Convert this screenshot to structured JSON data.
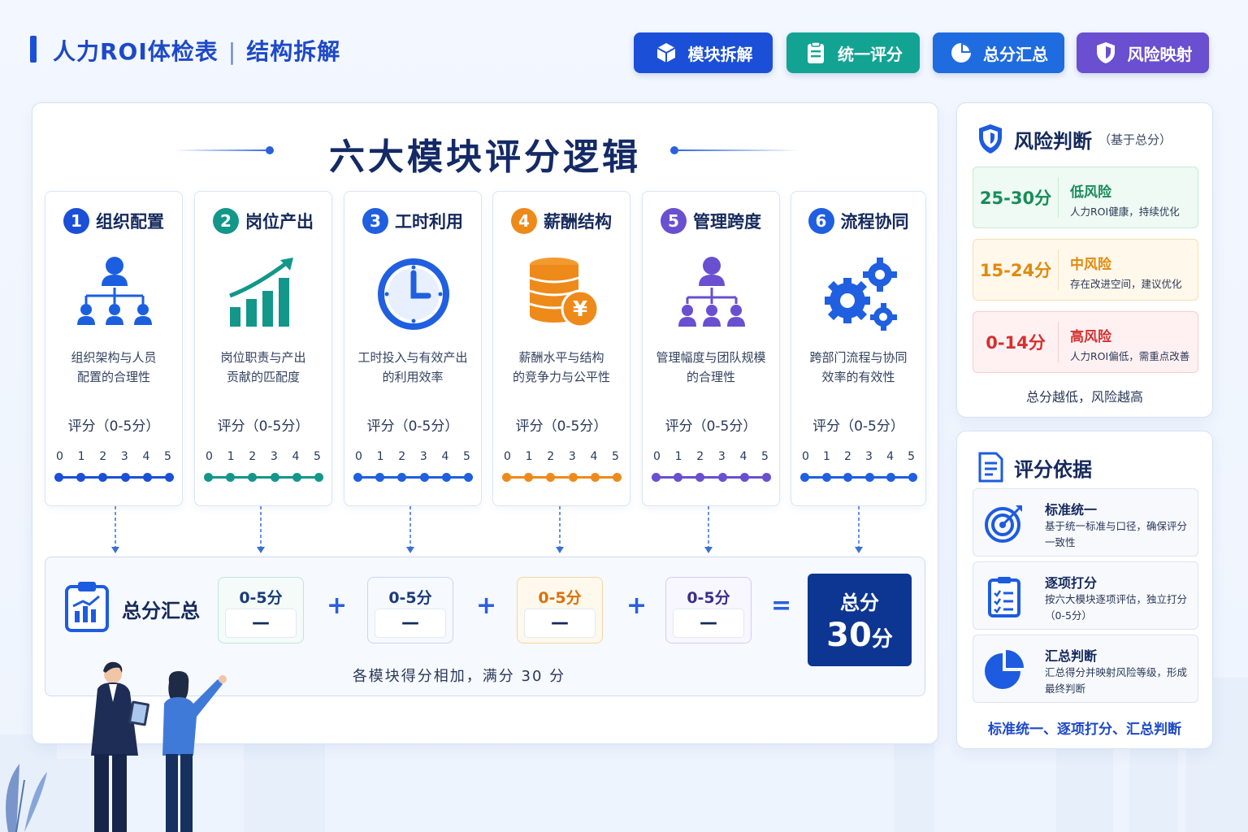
{
  "header": {
    "title": "人力ROI体检表",
    "subtitle": "结构拆解"
  },
  "tabs": [
    {
      "label": "模块拆解",
      "color": "#1b4fd8",
      "icon": "cube-icon"
    },
    {
      "label": "统一评分",
      "color": "#12a393",
      "icon": "clipboard-icon"
    },
    {
      "label": "总分汇总",
      "color": "#1f6be0",
      "icon": "pie-chart-icon"
    },
    {
      "label": "风险映射",
      "color": "#6a4fd0",
      "icon": "shield-icon"
    }
  ],
  "main": {
    "title": "六大模块评分逻辑",
    "modules": [
      {
        "num": "1",
        "name": "组织配置",
        "desc1": "组织架构与人员",
        "desc2": "配置的合理性",
        "score": "评分（0-5分）",
        "color": "#1b4fd8",
        "icon": "org-chart-icon"
      },
      {
        "num": "2",
        "name": "岗位产出",
        "desc1": "岗位职责与产出",
        "desc2": "贡献的匹配度",
        "score": "评分（0-5分）",
        "color": "#12978a",
        "icon": "growth-chart-icon"
      },
      {
        "num": "3",
        "name": "工时利用",
        "desc1": "工时投入与有效产出",
        "desc2": "的利用效率",
        "score": "评分（0-5分）",
        "color": "#1f5fe0",
        "icon": "clock-icon"
      },
      {
        "num": "4",
        "name": "薪酬结构",
        "desc1": "薪酬水平与结构",
        "desc2": "的竞争力与公平性",
        "score": "评分（0-5分）",
        "color": "#ee8a1a",
        "icon": "coins-yen-icon"
      },
      {
        "num": "5",
        "name": "管理跨度",
        "desc1": "管理幅度与团队规模",
        "desc2": "的合理性",
        "score": "评分（0-5分）",
        "color": "#6a4fd0",
        "icon": "hierarchy-icon"
      },
      {
        "num": "6",
        "name": "流程协同",
        "desc1": "跨部门流程与协同",
        "desc2": "效率的有效性",
        "score": "评分（0-5分）",
        "color": "#1f5fe0",
        "icon": "gears-icon"
      }
    ],
    "scale_labels": [
      "0",
      "1",
      "2",
      "3",
      "4",
      "5"
    ]
  },
  "summary": {
    "label": "总分汇总",
    "boxes": [
      {
        "value": "0-5分",
        "dash": "—",
        "color": "#1b3c7a",
        "border": "#bfe6da",
        "bg": "#f4fbf8"
      },
      {
        "value": "0-5分",
        "dash": "—",
        "color": "#1b3c7a",
        "border": "#c9d7ee",
        "bg": "#f6f9fe"
      },
      {
        "value": "0-5分",
        "dash": "—",
        "color": "#d9720c",
        "border": "#f3d7a6",
        "bg": "#fff8ec"
      },
      {
        "value": "0-5分",
        "dash": "—",
        "color": "#3b2f8a",
        "border": "#d6cdf0",
        "bg": "#f8f6fe"
      }
    ],
    "ops": [
      "+",
      "+",
      "+",
      "="
    ],
    "total_label": "总分",
    "total_value": "30",
    "total_unit": "分",
    "footnote": "各模块得分相加，满分 30 分"
  },
  "risk": {
    "title": "风险判断",
    "subtitle": "（基于总分）",
    "levels": [
      {
        "range": "25-30分",
        "level": "低风险",
        "text": "人力ROI健康，持续优化",
        "color": "#178c5a",
        "bg": "#eefaf3",
        "border": "#c6ead6"
      },
      {
        "range": "15-24分",
        "level": "中风险",
        "text": "存在改进空间，建议优化",
        "color": "#e08a0c",
        "bg": "#fff8eb",
        "border": "#f5dfb5"
      },
      {
        "range": "0-14分",
        "level": "高风险",
        "text": "人力ROI偏低，需重点改善",
        "color": "#d63030",
        "bg": "#fff1f1",
        "border": "#f5cccc"
      }
    ],
    "footnote": "总分越低，风险越高"
  },
  "basis": {
    "title": "评分依据",
    "items": [
      {
        "title": "标准统一",
        "desc": "基于统一标准与口径，确保评分一致性",
        "icon": "target-icon"
      },
      {
        "title": "逐项打分",
        "desc": "按六大模块逐项评估，独立打分（0-5分）",
        "icon": "checklist-icon"
      },
      {
        "title": "汇总判断",
        "desc": "汇总得分并映射风险等级，形成最终判断",
        "icon": "pie-chart-icon"
      }
    ],
    "footnote": "标准统一、逐项打分、汇总判断"
  }
}
